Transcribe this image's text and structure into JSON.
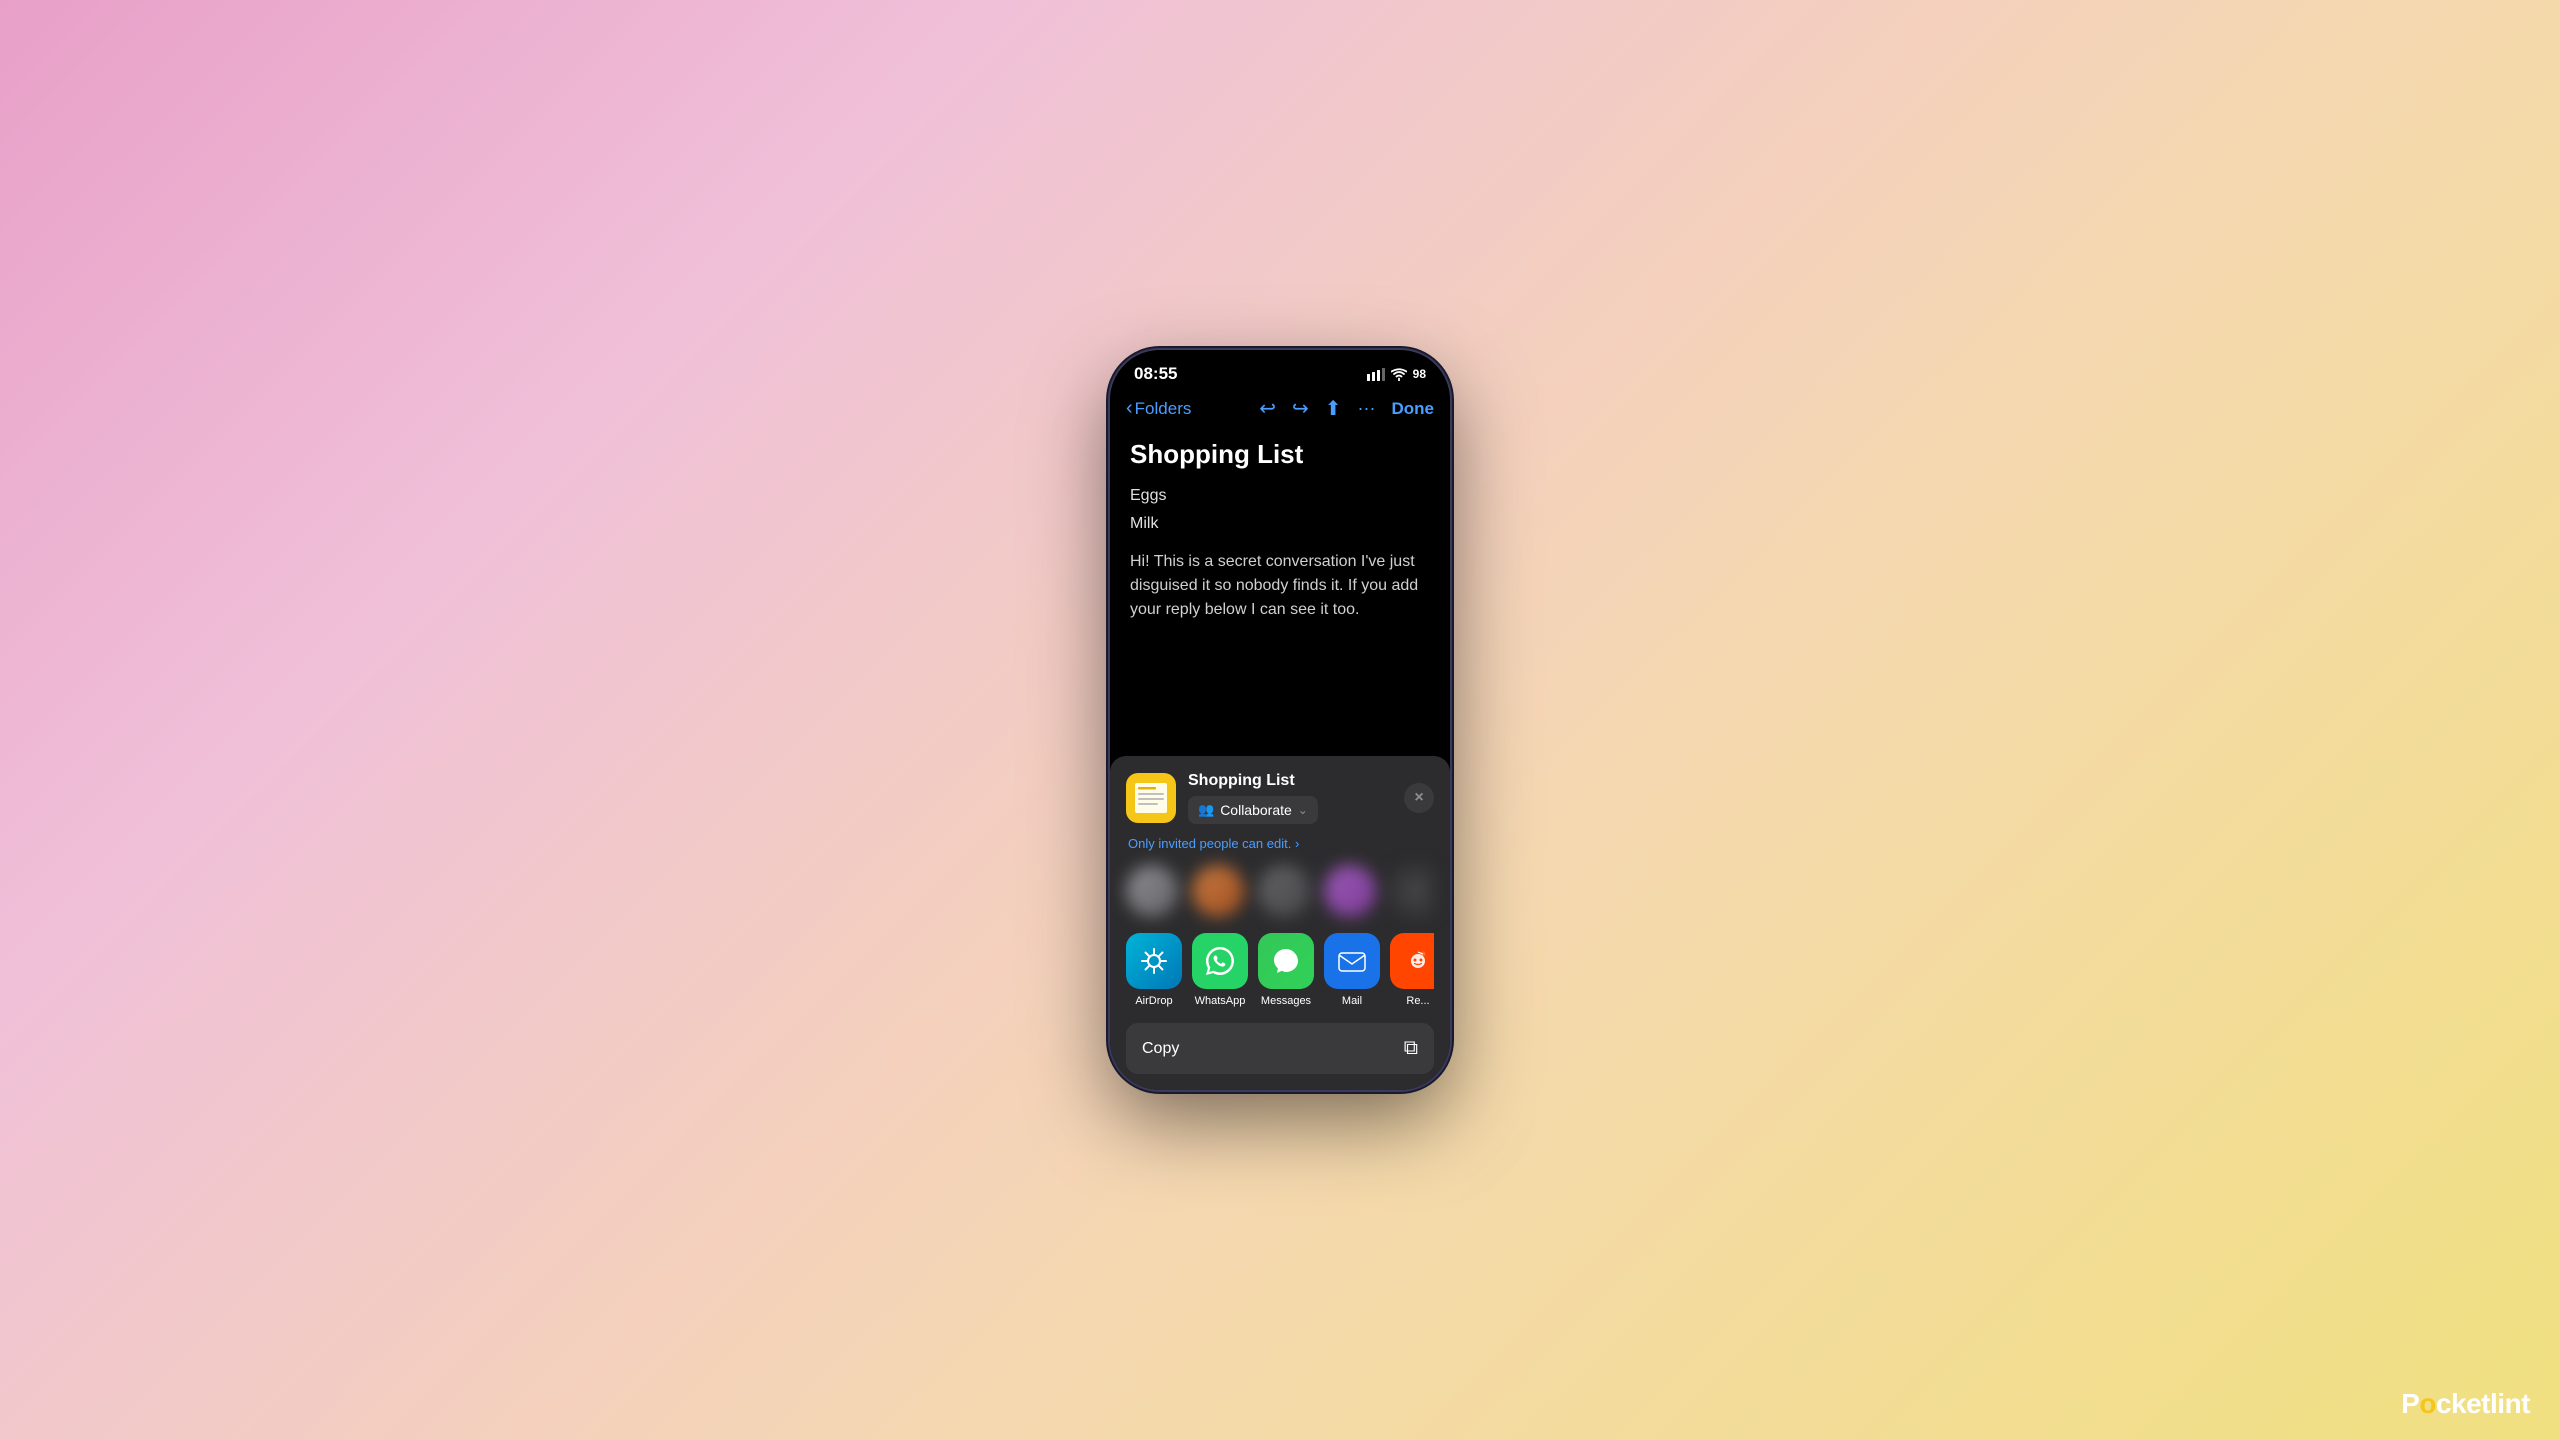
{
  "background": {
    "gradient": "pink to yellow"
  },
  "phone": {
    "status_bar": {
      "time": "08:55",
      "battery": "98"
    },
    "nav": {
      "back_label": "Folders",
      "done_label": "Done"
    },
    "note": {
      "title": "Shopping List",
      "items": [
        "Eggs",
        "Milk"
      ],
      "body": "Hi! This is a secret conversation I've just disguised it so nobody finds it. If you add your reply below I can see it too."
    },
    "share_sheet": {
      "app_name": "Shopping List",
      "collaborate_label": "Collaborate",
      "permission_text": "Only invited people can edit.",
      "close_button_label": "×",
      "contacts": [
        {
          "id": 1,
          "label": ""
        },
        {
          "id": 2,
          "label": ""
        },
        {
          "id": 3,
          "label": ""
        },
        {
          "id": 4,
          "label": ""
        },
        {
          "id": 5,
          "label": ""
        }
      ],
      "apps": [
        {
          "name": "AirDrop",
          "icon": "airdrop"
        },
        {
          "name": "WhatsApp",
          "icon": "whatsapp"
        },
        {
          "name": "Messages",
          "icon": "messages"
        },
        {
          "name": "Mail",
          "icon": "mail"
        },
        {
          "name": "Re...",
          "icon": "reddit"
        }
      ],
      "copy_label": "Copy"
    }
  },
  "pocketlint": {
    "label": "Pocketlint"
  }
}
